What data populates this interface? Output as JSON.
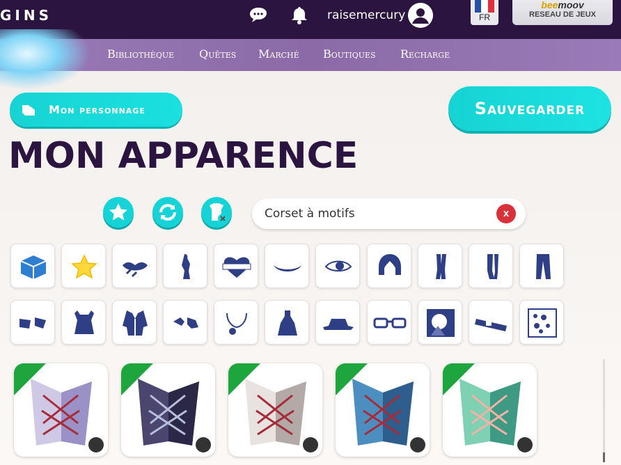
{
  "header": {
    "logo": "GINS",
    "username": "raisemercury",
    "lang_code": "FR",
    "partner_brand_a": "bee",
    "partner_brand_b": "moov",
    "partner_sub": "RESEAU DE JEUX"
  },
  "nav": [
    "Bibliothèque",
    "Quêtes",
    "Marché",
    "Boutiques",
    "Recharge"
  ],
  "buttons": {
    "character": "Mon personnage",
    "save": "Sauvegarder"
  },
  "page_title": "MON APPARENCE",
  "filters": [
    "favorites-star-icon",
    "refresh-icon",
    "remove-clothes-icon"
  ],
  "search": {
    "value": "Corset à motifs",
    "clear_label": "x"
  },
  "categories_row1": [
    "box-icon",
    "star-icon",
    "lips-icon",
    "skin-icon",
    "tattoo-icon",
    "mouth-icon",
    "eye-icon",
    "hair-icon",
    "socks-icon",
    "stockings-icon",
    "pants-icon"
  ],
  "categories_row2": [
    "gloves-icon",
    "top-icon",
    "jacket-icon",
    "accessory-icon",
    "necklace-icon",
    "dress-icon",
    "hat-icon",
    "glasses-icon",
    "background-icon",
    "belt-icon",
    "filler-icon"
  ],
  "items": [
    {
      "name": "corset-lavender",
      "main": "#cfc9e6",
      "shade": "#9a92c7",
      "lace": "#a72c3a"
    },
    {
      "name": "corset-dark",
      "main": "#4a4670",
      "shade": "#2a2747",
      "lace": "#b8bdd8"
    },
    {
      "name": "corset-white",
      "main": "#e8e2e0",
      "shade": "#b3aaa8",
      "lace": "#a72c3a"
    },
    {
      "name": "corset-blue",
      "main": "#4d8ec0",
      "shade": "#2d5e8d",
      "lace": "#a72c3a"
    },
    {
      "name": "corset-green",
      "main": "#7fd1b3",
      "shade": "#3f9a83",
      "lace": "#f3b2a6"
    }
  ]
}
